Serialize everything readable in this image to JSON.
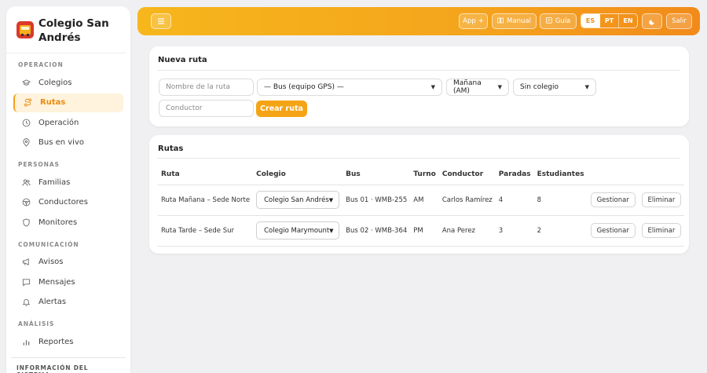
{
  "brand": {
    "name": "Colegio San Andrés"
  },
  "sidebar": {
    "sections": [
      {
        "label": "OPERACION",
        "items": [
          {
            "label": "Colegios",
            "icon": "graduation-cap-icon"
          },
          {
            "label": "Rutas",
            "icon": "route-icon",
            "active": true
          },
          {
            "label": "Operación",
            "icon": "clock-icon"
          },
          {
            "label": "Bus en vivo",
            "icon": "map-pin-icon"
          }
        ]
      },
      {
        "label": "PERSONAS",
        "items": [
          {
            "label": "Familias",
            "icon": "users-icon"
          },
          {
            "label": "Conductores",
            "icon": "steering-wheel-icon"
          },
          {
            "label": "Monitores",
            "icon": "shield-icon"
          }
        ]
      },
      {
        "label": "COMUNICACIÓN",
        "items": [
          {
            "label": "Avisos",
            "icon": "megaphone-icon"
          },
          {
            "label": "Mensajes",
            "icon": "message-icon"
          },
          {
            "label": "Alertas",
            "icon": "bell-icon"
          }
        ]
      },
      {
        "label": "ANÁLISIS",
        "items": [
          {
            "label": "Reportes",
            "icon": "bar-chart-icon"
          }
        ]
      }
    ],
    "system_info_label": "INFORMACIÓN DEL SISTEMA"
  },
  "topbar": {
    "app_label": "App",
    "manual_label": "Manual",
    "guide_label": "Guía",
    "languages": [
      "ES",
      "PT",
      "EN"
    ],
    "active_language": "ES",
    "logout_label": "Salir"
  },
  "new_route": {
    "title": "Nueva ruta",
    "name_placeholder": "Nombre de la ruta",
    "bus_select": "— Bus (equipo GPS) —",
    "shift_select": "Mañana (AM)",
    "school_select": "Sin colegio",
    "driver_placeholder": "Conductor",
    "create_label": "Crear ruta"
  },
  "routes": {
    "title": "Rutas",
    "columns": [
      "Ruta",
      "Colegio",
      "Bus",
      "Turno",
      "Conductor",
      "Paradas",
      "Estudiantes"
    ],
    "rows": [
      {
        "ruta": "Ruta Mañana – Sede Norte",
        "colegio": "Colegio San Andrés",
        "bus": "Bus 01 · WMB-255",
        "turno": "AM",
        "conductor": "Carlos Ramírez",
        "paradas": "4",
        "estudiantes": "8"
      },
      {
        "ruta": "Ruta Tarde – Sede Sur",
        "colegio": "Colegio Marymount",
        "bus": "Bus 02 · WMB-364",
        "turno": "PM",
        "conductor": "Ana Perez",
        "paradas": "3",
        "estudiantes": "2"
      }
    ],
    "manage_label": "Gestionar",
    "delete_label": "Eliminar"
  },
  "colors": {
    "accent": "#f5a416",
    "accent_dark": "#f28a1a",
    "active_bg": "#fff3dd"
  }
}
